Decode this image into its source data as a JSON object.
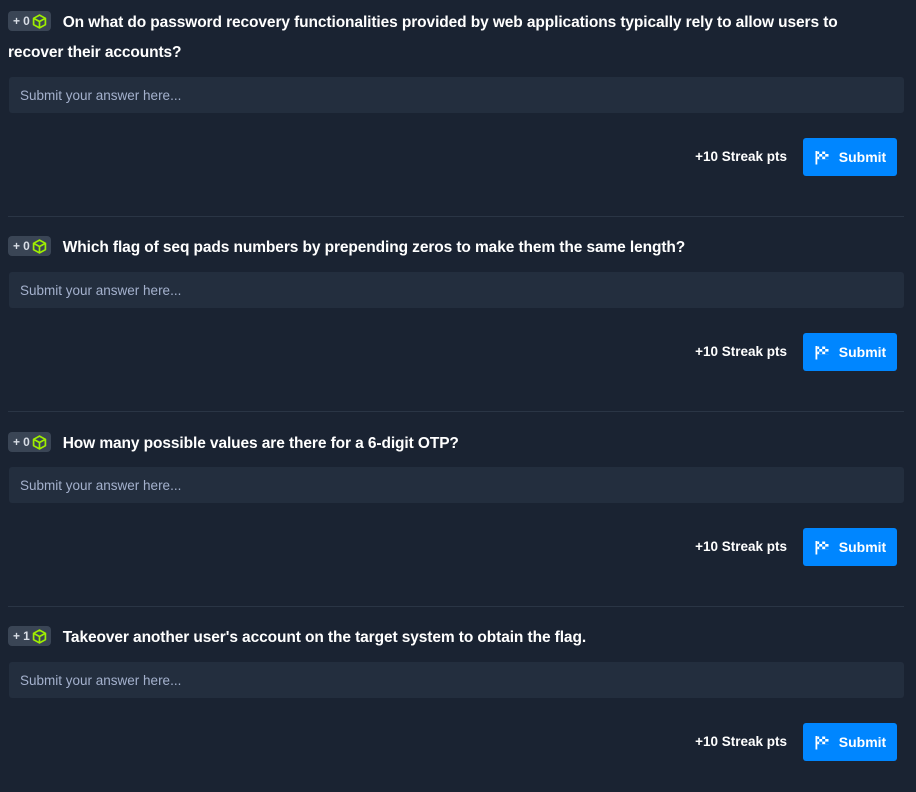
{
  "questions": [
    {
      "points": "+ 0",
      "text": "On what do password recovery functionalities provided by web applications typically rely to allow users to recover their accounts?",
      "placeholder": "Submit your answer here...",
      "streak": "+10 Streak pts",
      "submit_label": "Submit"
    },
    {
      "points": "+ 0",
      "text": "Which flag of seq pads numbers by prepending zeros to make them the same length?",
      "placeholder": "Submit your answer here...",
      "streak": "+10 Streak pts",
      "submit_label": "Submit"
    },
    {
      "points": "+ 0",
      "text": "How many possible values are there for a 6-digit OTP?",
      "placeholder": "Submit your answer here...",
      "streak": "+10 Streak pts",
      "submit_label": "Submit"
    },
    {
      "points": "+ 1",
      "text": "Takeover another user's account on the target system to obtain the flag.",
      "placeholder": "Submit your answer here...",
      "streak": "+10 Streak pts",
      "submit_label": "Submit"
    }
  ],
  "icons": {
    "badge_icon": "cube-icon",
    "submit_icon": "flag-icon"
  },
  "colors": {
    "background": "#1a2332",
    "input_background": "#232e3e",
    "accent": "#0086ff",
    "cube": "#9fef00"
  }
}
